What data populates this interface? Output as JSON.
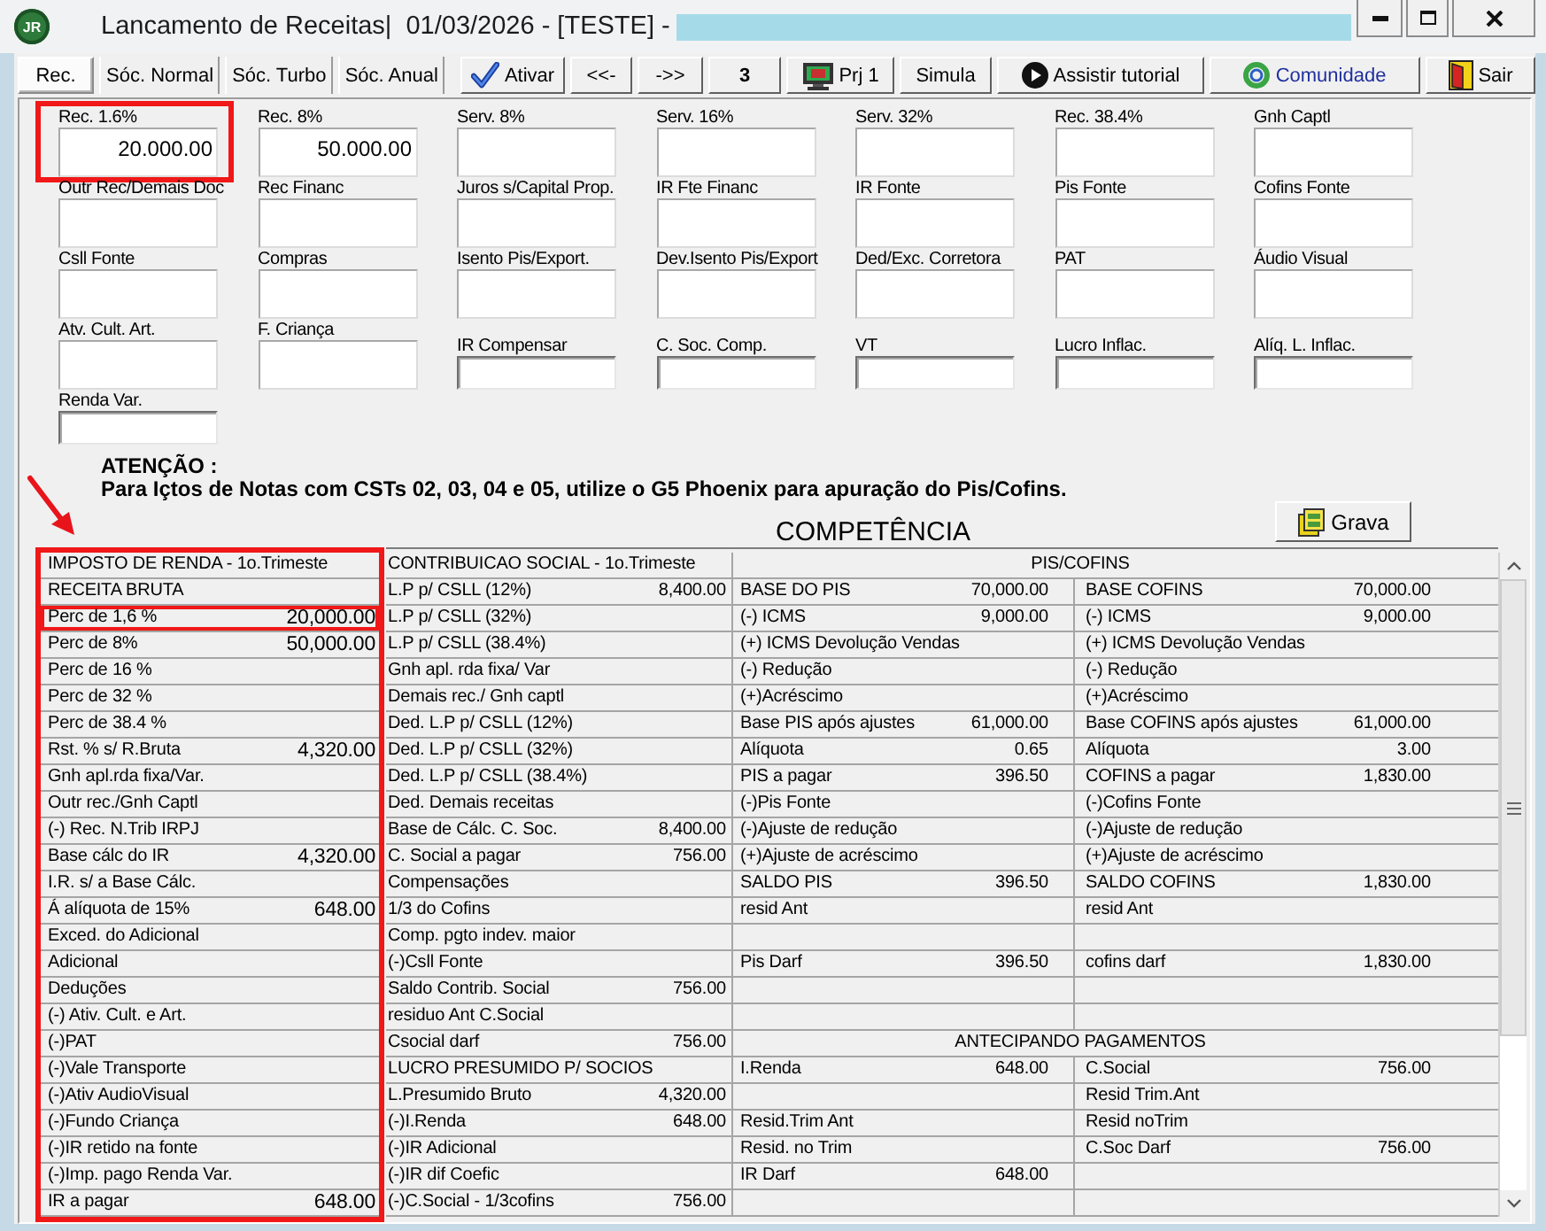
{
  "window": {
    "logo": "JR",
    "title": "Lancamento de Receitas|  01/03/2026 - [TESTE] -"
  },
  "tabs": [
    {
      "label": "Rec.",
      "selected": true
    },
    {
      "label": "Sóc. Normal",
      "selected": false
    },
    {
      "label": "Sóc. Turbo",
      "selected": false
    },
    {
      "label": "Sóc. Anual",
      "selected": false
    }
  ],
  "toolbar": [
    {
      "label": "Ativar",
      "kind": "activate"
    },
    {
      "label": "<<-",
      "kind": "prev"
    },
    {
      "label": "->>",
      "kind": "next"
    },
    {
      "label": "3",
      "kind": "counter"
    },
    {
      "label": "Prj 1",
      "kind": "project"
    },
    {
      "label": "Simula",
      "kind": "simulate"
    },
    {
      "label": "Assistir tutorial",
      "kind": "tutorial"
    },
    {
      "label": "Comunidade",
      "kind": "community"
    },
    {
      "label": "Sair",
      "kind": "exit"
    }
  ],
  "fields": [
    {
      "label": "Rec. 1.6%",
      "value": "20.000.00",
      "kind": "tall",
      "highlighted": true
    },
    {
      "label": "Rec. 8%",
      "value": "50.000.00",
      "kind": "tall",
      "highlighted": false
    },
    {
      "label": "Serv. 8%",
      "kind": "tall",
      "highlighted": false
    },
    {
      "label": "Serv. 16%",
      "kind": "tall",
      "highlighted": false
    },
    {
      "label": "Serv. 32%",
      "kind": "tall",
      "highlighted": false
    },
    {
      "label": "Rec. 38.4%",
      "kind": "tall",
      "highlighted": false
    },
    {
      "label": "Gnh Captl",
      "kind": "tall",
      "highlighted": false
    },
    {
      "label": "Outr Rec/Demais Doc",
      "kind": "tall",
      "highlighted": false
    },
    {
      "label": "Rec Financ",
      "kind": "tall",
      "highlighted": false
    },
    {
      "label": "Juros s/Capital Prop.",
      "kind": "tall",
      "highlighted": false
    },
    {
      "label": "IR Fte Financ",
      "kind": "tall",
      "highlighted": false
    },
    {
      "label": "IR Fonte",
      "kind": "tall",
      "highlighted": false
    },
    {
      "label": "Pis Fonte",
      "kind": "tall",
      "highlighted": false
    },
    {
      "label": "Cofins Fonte",
      "kind": "tall",
      "highlighted": false
    },
    {
      "label": "Csll Fonte",
      "kind": "tall",
      "highlighted": false
    },
    {
      "label": "Compras",
      "kind": "tall",
      "highlighted": false
    },
    {
      "label": "Isento Pis/Export.",
      "kind": "tall",
      "highlighted": false
    },
    {
      "label": "Dev.Isento Pis/Export",
      "kind": "tall",
      "highlighted": false
    },
    {
      "label": "Ded/Exc. Corretora",
      "kind": "tall",
      "highlighted": false
    },
    {
      "label": "PAT",
      "kind": "tall",
      "highlighted": false
    },
    {
      "label": "Áudio Visual",
      "kind": "tall",
      "highlighted": false
    },
    {
      "label": "Atv. Cult. Art.",
      "kind": "tall",
      "highlighted": false
    },
    {
      "label": "F. Criança",
      "kind": "tall",
      "highlighted": false
    },
    {
      "label": "IR Compensar",
      "kind": "short",
      "highlighted": false
    },
    {
      "label": "C. Soc. Comp.",
      "kind": "short",
      "highlighted": false
    },
    {
      "label": "VT",
      "kind": "short",
      "highlighted": false
    },
    {
      "label": "Lucro Inflac.",
      "kind": "short",
      "highlighted": false
    },
    {
      "label": "Alíq. L. Inflac.",
      "kind": "short",
      "highlighted": false
    },
    {
      "label": "Renda Var.",
      "kind": "short",
      "highlighted": false
    }
  ],
  "notice": {
    "heading": "ATENÇÃO :",
    "text": "Para Içtos de Notas com CSTs 02, 03, 04 e 05, utilize o G5 Phoenix para apuração do Pis/Cofins."
  },
  "competencia": {
    "title": "COMPETÊNCIA",
    "save_button": "Grava"
  },
  "income_tax": {
    "title": "IMPOSTO DE RENDA - 1o.Trimeste",
    "highlighted": true,
    "rows": [
      {
        "label": "RECEITA BRUTA",
        "highlighted": false
      },
      {
        "label": "Perc de 1,6 %",
        "value": "20,000.00",
        "highlighted": true
      },
      {
        "label": "Perc de 8%",
        "value": "50,000.00",
        "highlighted": false
      },
      {
        "label": "Perc de 16 %",
        "highlighted": false
      },
      {
        "label": "Perc de 32 %",
        "highlighted": false
      },
      {
        "label": "Perc de 38.4 %",
        "highlighted": false
      },
      {
        "label": "Rst. % s/ R.Bruta",
        "value": "4,320.00",
        "highlighted": false
      },
      {
        "label": "Gnh apl.rda fixa/Var.",
        "highlighted": false
      },
      {
        "label": "Outr rec./Gnh Captl",
        "highlighted": false
      },
      {
        "label": "(-) Rec. N.Trib IRPJ",
        "highlighted": false
      },
      {
        "label": "Base cálc do IR",
        "value": "4,320.00",
        "highlighted": false
      },
      {
        "label": "I.R. s/ a Base Cálc.",
        "highlighted": false
      },
      {
        "label": "Á alíquota de 15%",
        "value": "648.00",
        "highlighted": false
      },
      {
        "label": "Exced. do Adicional",
        "highlighted": false
      },
      {
        "label": "Adicional",
        "highlighted": false
      },
      {
        "label": "Deduções",
        "highlighted": false
      },
      {
        "label": "(-) Ativ. Cult. e Art.",
        "highlighted": false
      },
      {
        "label": "(-)PAT",
        "highlighted": false
      },
      {
        "label": "(-)Vale Transporte",
        "highlighted": false
      },
      {
        "label": "(-)Ativ AudioVisual",
        "highlighted": false
      },
      {
        "label": "(-)Fundo Criança",
        "highlighted": false
      },
      {
        "label": "(-)IR retido na fonte",
        "highlighted": false
      },
      {
        "label": "(-)Imp. pago Renda Var.",
        "highlighted": false
      },
      {
        "label": "IR a pagar",
        "value": "648.00",
        "highlighted": false
      }
    ]
  },
  "social_contribution": {
    "title": "CONTRIBUICAO SOCIAL - 1o.Trimeste",
    "rows": [
      {
        "label": "L.P p/ CSLL (12%)",
        "value": "8,400.00"
      },
      {
        "label": "L.P p/ CSLL (32%)"
      },
      {
        "label": "L.P p/ CSLL (38.4%)"
      },
      {
        "label": "Gnh apl. rda fixa/ Var"
      },
      {
        "label": "Demais rec./ Gnh captl"
      },
      {
        "label": "Ded. L.P p/ CSLL (12%)"
      },
      {
        "label": "Ded. L.P p/ CSLL (32%)"
      },
      {
        "label": "Ded. L.P p/ CSLL (38.4%)"
      },
      {
        "label": "Ded. Demais receitas"
      },
      {
        "label": "Base de Cálc. C. Soc.",
        "value": "8,400.00"
      },
      {
        "label": "C. Social a pagar",
        "value": "756.00"
      },
      {
        "label": "Compensações"
      },
      {
        "label": "1/3 do Cofins"
      },
      {
        "label": "Comp. pgto indev. maior"
      },
      {
        "label": "(-)Csll Fonte"
      },
      {
        "label": "Saldo Contrib. Social",
        "value": "756.00"
      },
      {
        "label": "residuo Ant C.Social"
      },
      {
        "label": "Csocial darf",
        "value": "756.00"
      },
      {
        "label": "LUCRO PRESUMIDO P/ SOCIOS"
      },
      {
        "label": "L.Presumido Bruto",
        "value": "4,320.00"
      },
      {
        "label": "(-)I.Renda",
        "value": "648.00"
      },
      {
        "label": "(-)IR Adicional"
      },
      {
        "label": "(-)IR dif Coefic"
      },
      {
        "label": "(-)C.Social - 1/3cofins",
        "value": "756.00"
      }
    ]
  },
  "pis_cofins": {
    "title": "PIS/COFINS",
    "rows": [
      {
        "kind": "pair",
        "left": {
          "label": "BASE DO PIS",
          "value": "70,000.00"
        },
        "right": {
          "label": "BASE COFINS",
          "value": "70,000.00"
        }
      },
      {
        "kind": "pair",
        "left": {
          "label": "(-) ICMS",
          "value": "9,000.00"
        },
        "right": {
          "label": "(-) ICMS",
          "value": "9,000.00"
        }
      },
      {
        "kind": "pair",
        "left": {
          "label": "(+) ICMS Devolução Vendas"
        },
        "right": {
          "label": "(+) ICMS Devolução Vendas"
        }
      },
      {
        "kind": "pair",
        "left": {
          "label": "(-) Redução"
        },
        "right": {
          "label": "(-) Redução"
        }
      },
      {
        "kind": "pair",
        "left": {
          "label": "(+)Acréscimo"
        },
        "right": {
          "label": "(+)Acréscimo"
        }
      },
      {
        "kind": "pair",
        "left": {
          "label": "Base PIS após ajustes",
          "value": "61,000.00"
        },
        "right": {
          "label": "Base COFINS após ajustes",
          "value": "61,000.00"
        }
      },
      {
        "kind": "pair",
        "left": {
          "label": "Alíquota",
          "value": "0.65"
        },
        "right": {
          "label": "Alíquota",
          "value": "3.00"
        }
      },
      {
        "kind": "pair",
        "left": {
          "label": "PIS a pagar",
          "value": "396.50"
        },
        "right": {
          "label": "COFINS a pagar",
          "value": "1,830.00"
        }
      },
      {
        "kind": "pair",
        "left": {
          "label": "(-)Pis Fonte"
        },
        "right": {
          "label": "(-)Cofins Fonte"
        }
      },
      {
        "kind": "pair",
        "left": {
          "label": "(-)Ajuste de redução"
        },
        "right": {
          "label": "(-)Ajuste de redução"
        }
      },
      {
        "kind": "pair",
        "left": {
          "label": "(+)Ajuste de acréscimo"
        },
        "right": {
          "label": "(+)Ajuste de acréscimo"
        }
      },
      {
        "kind": "pair",
        "left": {
          "label": "SALDO PIS",
          "value": "396.50"
        },
        "right": {
          "label": "SALDO COFINS",
          "value": "1,830.00"
        }
      },
      {
        "kind": "pair",
        "left": {
          "label": "resid Ant"
        },
        "right": {
          "label": "resid Ant"
        }
      },
      {
        "kind": "pair"
      },
      {
        "kind": "pair",
        "left": {
          "label": "Pis Darf",
          "value": "396.50"
        },
        "right": {
          "label": "cofins darf",
          "value": "1,830.00"
        }
      },
      {
        "kind": "pair"
      },
      {
        "kind": "pair"
      },
      {
        "kind": "heading",
        "label": "ANTECIPANDO PAGAMENTOS"
      },
      {
        "kind": "pair",
        "left": {
          "label": "I.Renda",
          "value": "648.00"
        },
        "right": {
          "label": "C.Social",
          "value": "756.00"
        }
      },
      {
        "kind": "pair",
        "right": {
          "label": "Resid Trim.Ant"
        }
      },
      {
        "kind": "pair",
        "left": {
          "label": "Resid.Trim Ant"
        },
        "right": {
          "label": "Resid noTrim"
        }
      },
      {
        "kind": "pair",
        "left": {
          "label": "Resid. no Trim"
        },
        "right": {
          "label": "C.Soc Darf",
          "value": "756.00"
        }
      },
      {
        "kind": "pair",
        "left": {
          "label": "IR Darf",
          "value": "648.00"
        }
      },
      {
        "kind": "pair"
      }
    ]
  }
}
